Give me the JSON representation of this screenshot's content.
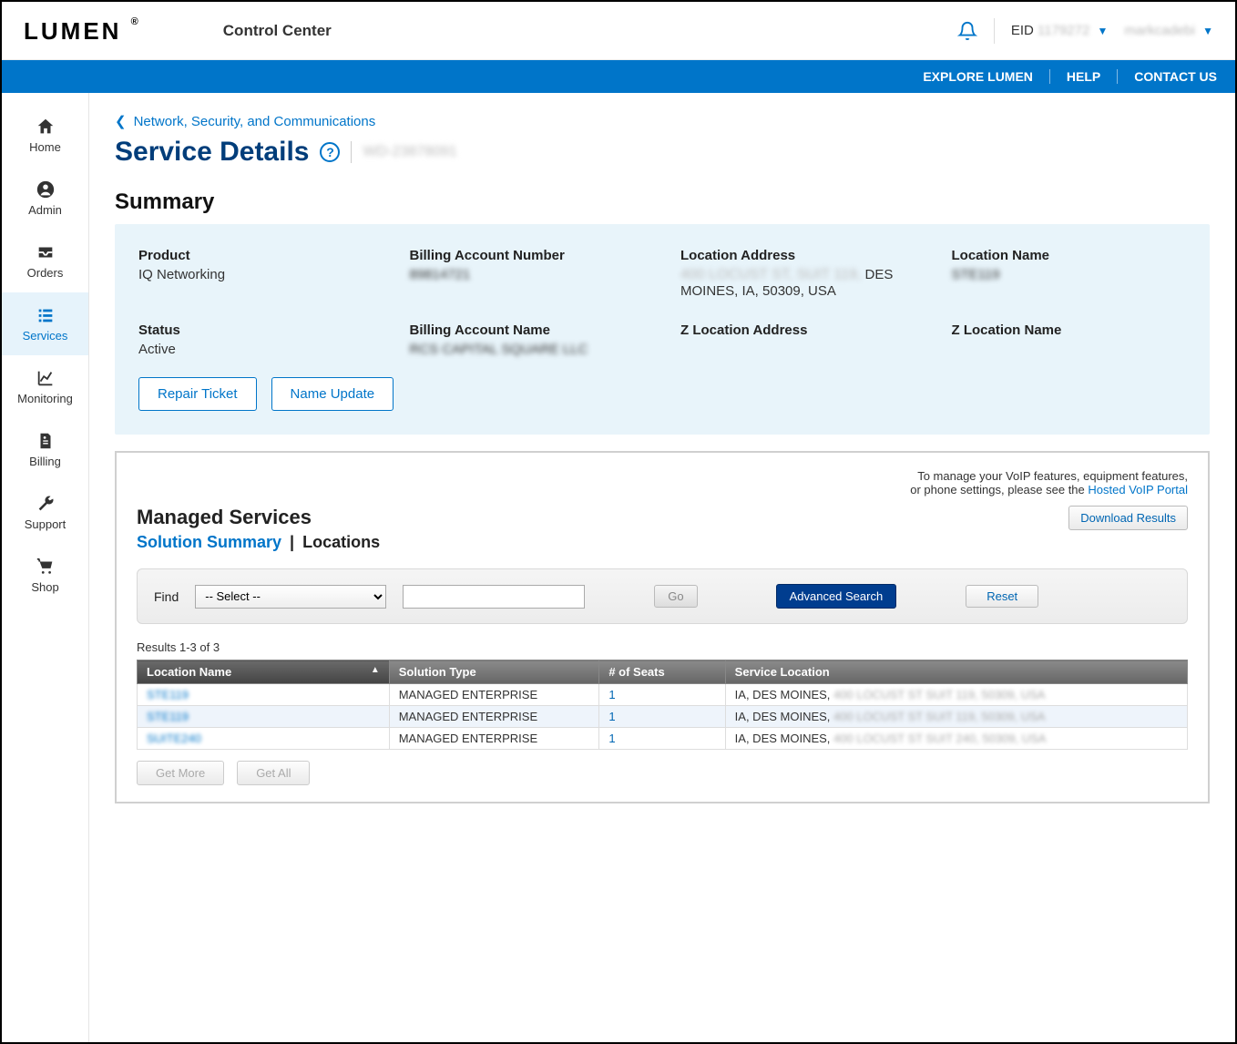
{
  "header": {
    "logo_text": "LUMEN",
    "app_name": "Control Center",
    "eid_label": "EID",
    "eid_value": "1179272",
    "username": "markcadebi"
  },
  "bluebar": {
    "explore": "EXPLORE LUMEN",
    "help": "HELP",
    "contact": "CONTACT US"
  },
  "sidebar": {
    "home": "Home",
    "admin": "Admin",
    "orders": "Orders",
    "services": "Services",
    "monitoring": "Monitoring",
    "billing": "Billing",
    "support": "Support",
    "shop": "Shop"
  },
  "breadcrumb": {
    "parent": "Network, Security, and Communications"
  },
  "page": {
    "title": "Service Details",
    "service_id": "WD-23878091"
  },
  "summary": {
    "heading": "Summary",
    "labels": {
      "product": "Product",
      "ban": "Billing Account Number",
      "addr": "Location Address",
      "locname": "Location Name",
      "status": "Status",
      "baname": "Billing Account Name",
      "zaddr": "Z Location Address",
      "zlocname": "Z Location Name"
    },
    "values": {
      "product": "IQ Networking",
      "ban": "89814721",
      "addr_blur": "400 LOCUST ST, SUIT 119,",
      "addr_tail": " DES MOINES, IA, 50309, USA",
      "locname": "STE119",
      "status": "Active",
      "baname": "RCS CAPITAL SQUARE LLC"
    },
    "buttons": {
      "repair": "Repair Ticket",
      "name_update": "Name Update"
    }
  },
  "managed": {
    "voip_note_1": "To manage your VoIP features, equipment features,",
    "voip_note_2": "or phone settings, please see the ",
    "voip_link": "Hosted VoIP Portal",
    "title": "Managed Services",
    "tab_solution": "Solution Summary",
    "tab_locations": "Locations",
    "download": "Download Results",
    "find_label": "Find",
    "select_placeholder": "-- Select --",
    "go": "Go",
    "advanced": "Advanced Search",
    "reset": "Reset",
    "results_meta": "Results 1-3 of 3",
    "columns": {
      "locname": "Location Name",
      "soltype": "Solution Type",
      "seats": "# of Seats",
      "svcloc": "Service Location"
    },
    "rows": [
      {
        "name": "STE119",
        "type": "MANAGED ENTERPRISE",
        "seats": "1",
        "loc_prefix": "IA, DES MOINES, ",
        "loc_blur": "400 LOCUST ST SUIT 119, 50309, USA"
      },
      {
        "name": "STE119",
        "type": "MANAGED ENTERPRISE",
        "seats": "1",
        "loc_prefix": "IA, DES MOINES, ",
        "loc_blur": "400 LOCUST ST SUIT 119, 50309, USA"
      },
      {
        "name": "SUITE240",
        "type": "MANAGED ENTERPRISE",
        "seats": "1",
        "loc_prefix": "IA, DES MOINES, ",
        "loc_blur": "400 LOCUST ST SUIT 240, 50309, USA"
      }
    ],
    "get_more": "Get More",
    "get_all": "Get All"
  }
}
